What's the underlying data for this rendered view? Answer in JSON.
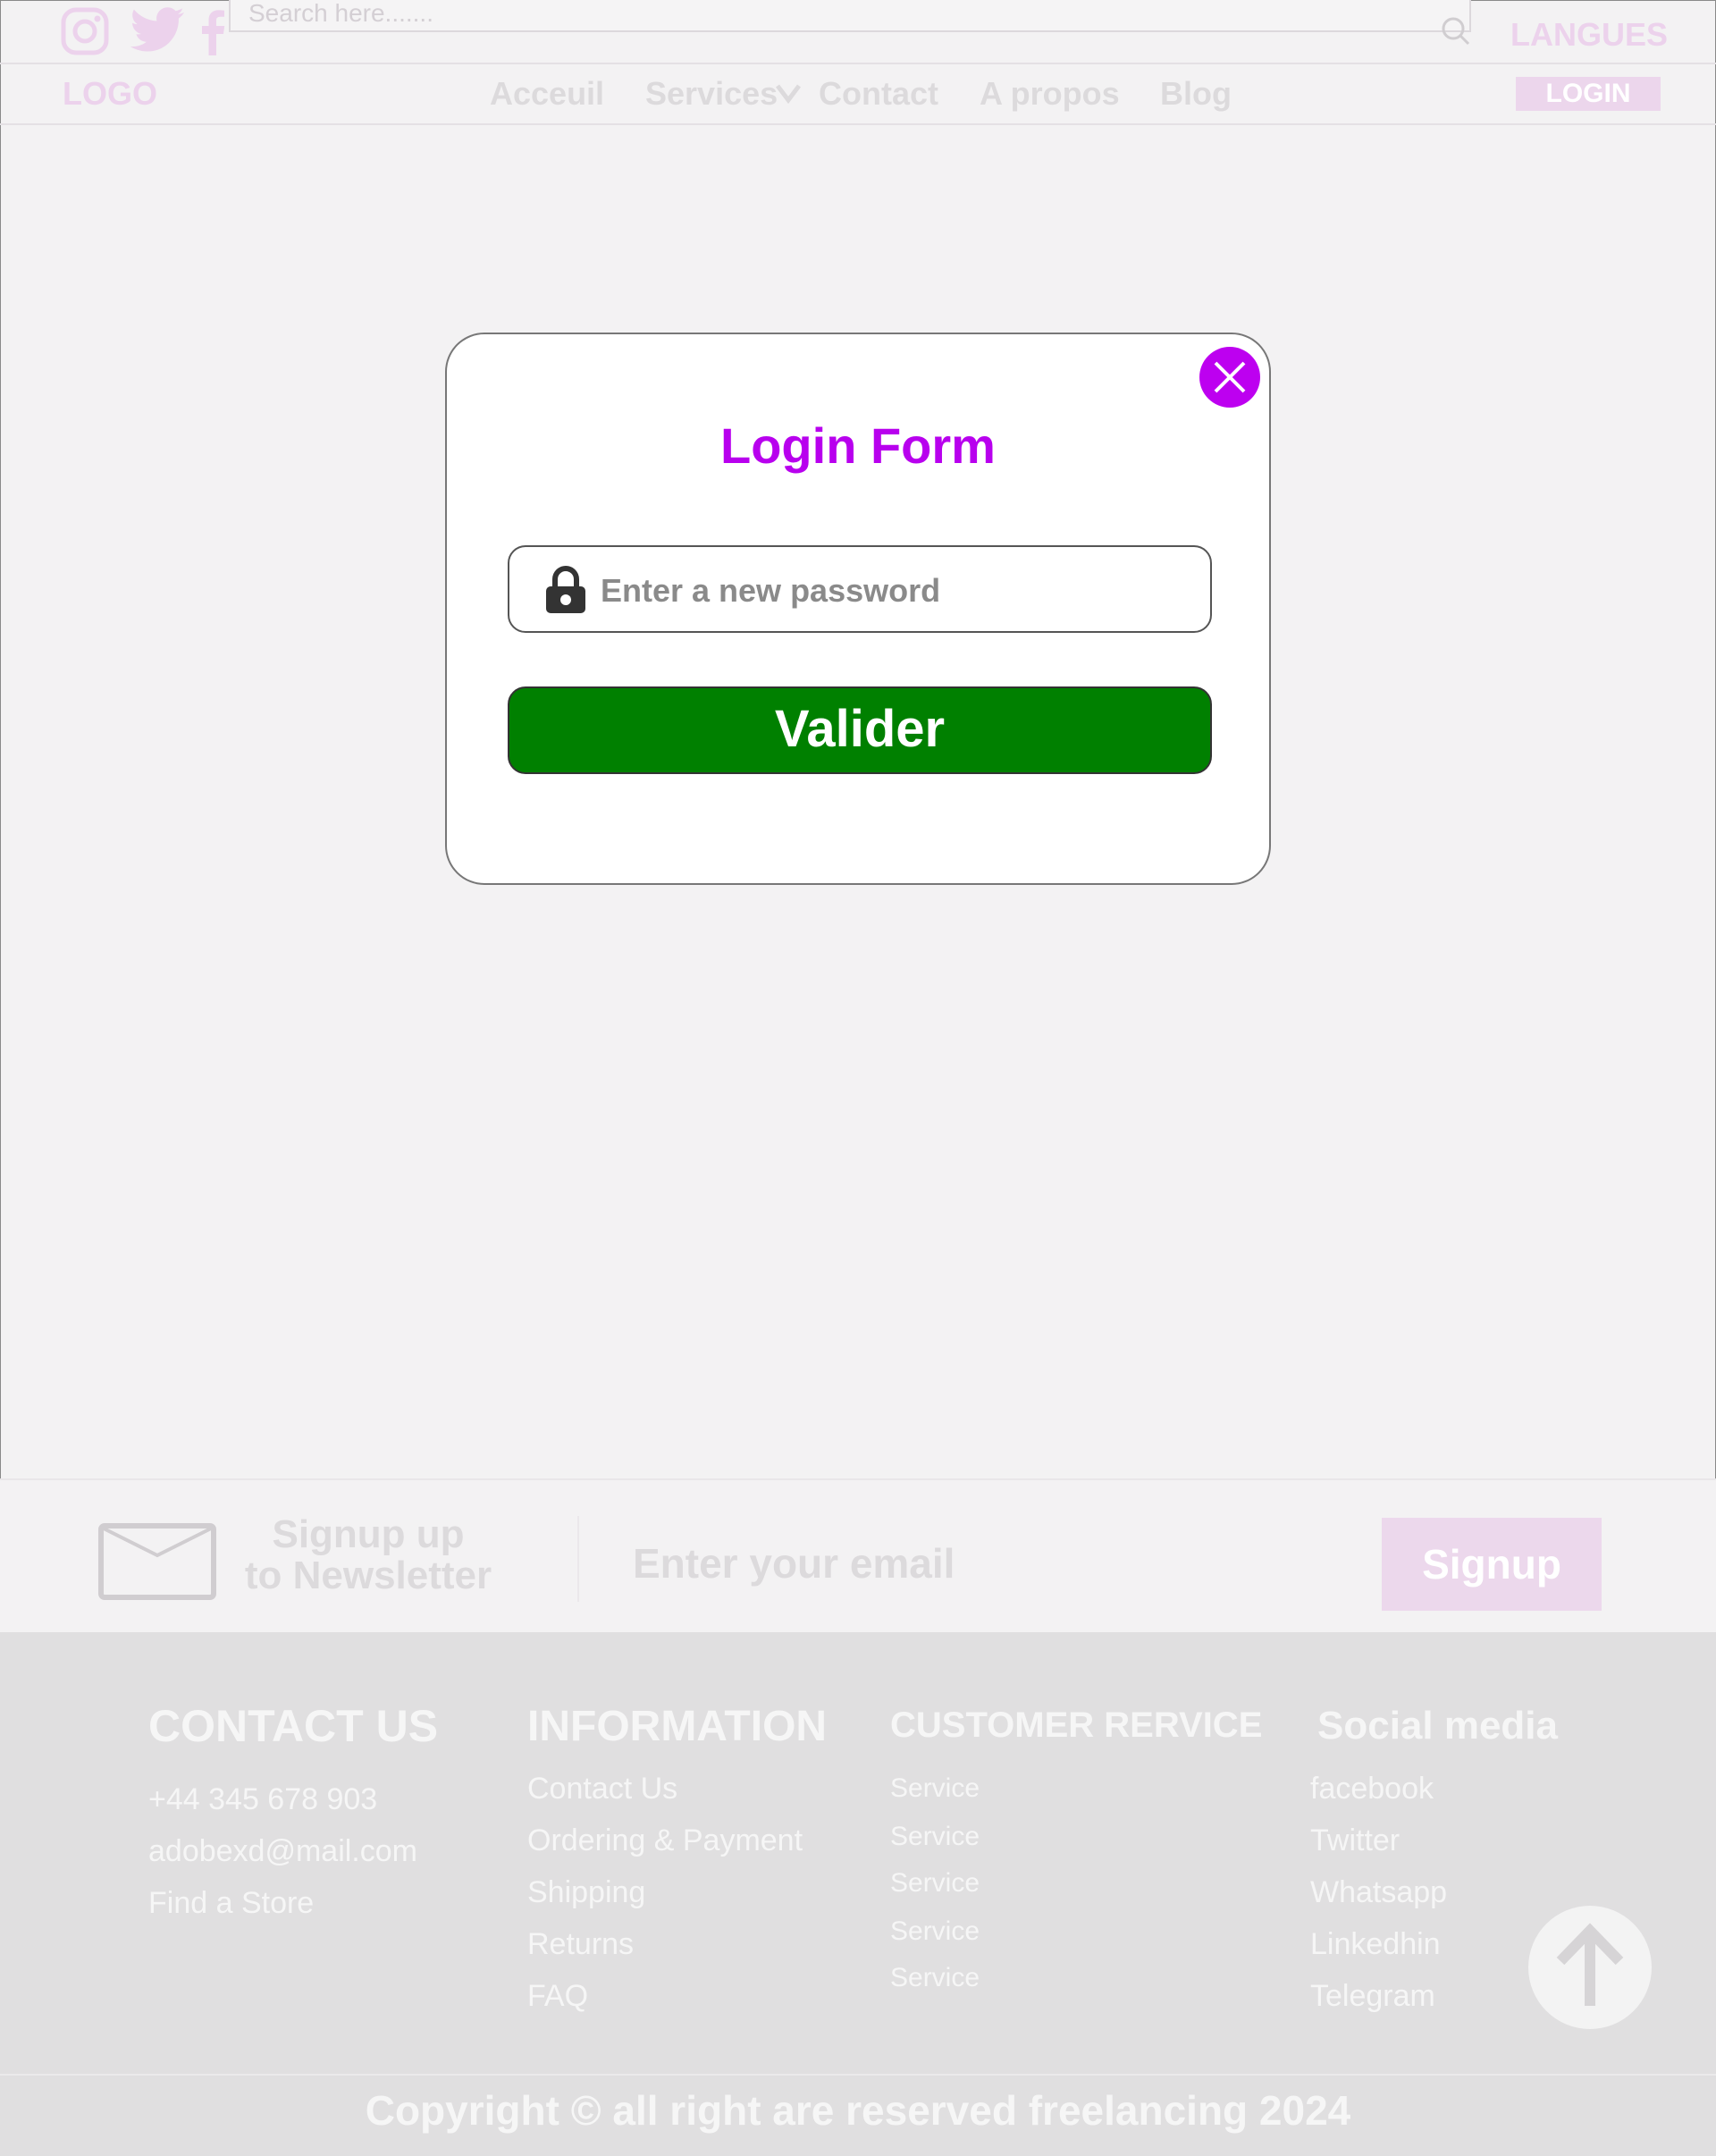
{
  "topbar": {
    "social_icons": [
      "instagram-icon",
      "twitter-icon",
      "facebook-icon"
    ],
    "search_placeholder": "Search here.......",
    "search_icon": "search-icon",
    "langues_label": "LANGUES"
  },
  "navbar": {
    "logo": "LOGO",
    "items": [
      {
        "label": "Acceuil"
      },
      {
        "label": "Services"
      },
      {
        "label": "Contact"
      },
      {
        "label": "A propos"
      },
      {
        "label": "Blog"
      }
    ],
    "login_label": "LOGIN"
  },
  "modal": {
    "title": "Login Form",
    "password_placeholder": "Enter a new password",
    "submit_label": "Valider",
    "close_icon": "close-icon",
    "lock_icon": "lock-icon"
  },
  "newsletter": {
    "line1": "Signup up",
    "line2": "to Newsletter",
    "email_placeholder": "Enter your email",
    "button_label": "Signup"
  },
  "footer": {
    "contact": {
      "title": "CONTACT US",
      "items": [
        "+44 345 678 903",
        "adobexd@mail.com",
        "Find a Store"
      ]
    },
    "information": {
      "title": "INFORMATION",
      "items": [
        "Contact Us",
        "Ordering & Payment",
        "Shipping",
        "Returns",
        "FAQ"
      ]
    },
    "customer": {
      "title": "CUSTOMER RERVICE",
      "items": [
        "Service",
        "Service",
        "Service",
        "Service",
        "Service"
      ]
    },
    "social": {
      "title": "Social media",
      "items": [
        "facebook",
        "Twitter",
        "Whatsapp",
        "Linkedhin",
        "Telegram"
      ]
    },
    "copyright": "Copyright © all right are reserved freelancing 2024"
  },
  "colors": {
    "accent": "#bd00f0",
    "title": "#b800ee",
    "submit": "#008000",
    "faded_pink": "#ecd2ec"
  }
}
